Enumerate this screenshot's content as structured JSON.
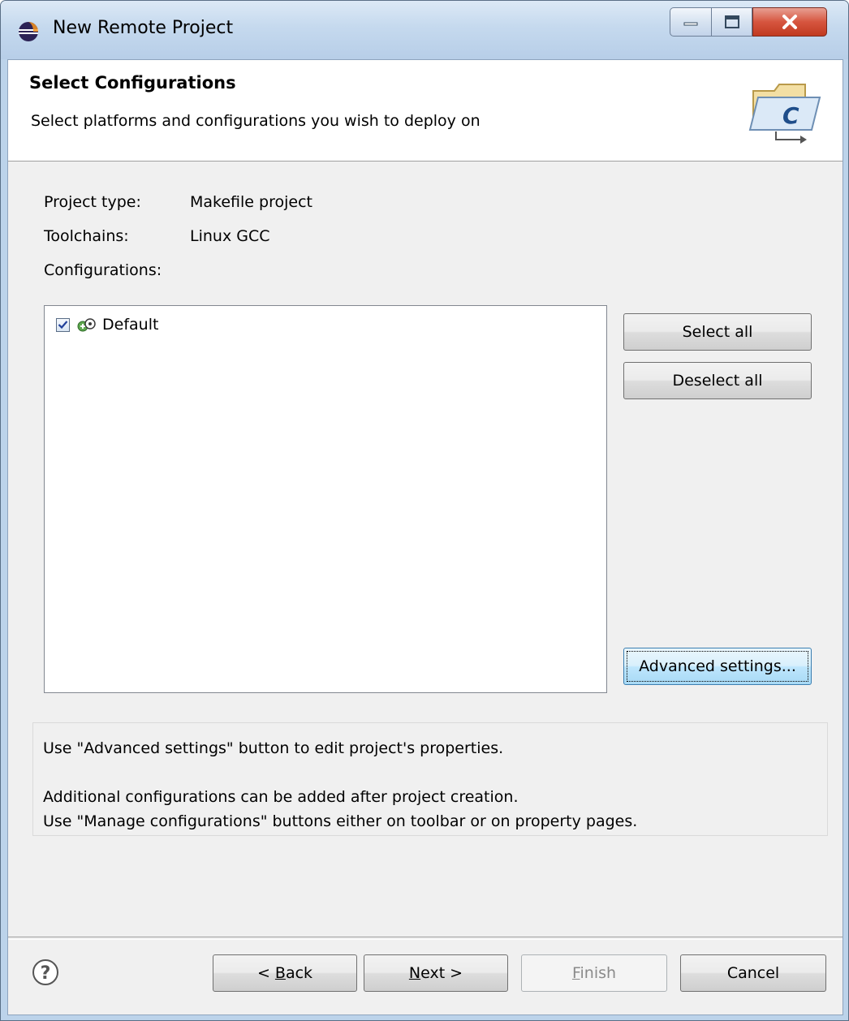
{
  "window": {
    "title": "New Remote Project",
    "controls": {
      "minimize_icon": "minimize-icon",
      "maximize_icon": "maximize-icon",
      "close_icon": "close-icon"
    }
  },
  "banner": {
    "title": "Select Configurations",
    "description": "Select platforms and configurations you wish to deploy on",
    "icon": "c-project-folder-icon"
  },
  "info": {
    "project_type_label": "Project type:",
    "project_type_value": "Makefile project",
    "toolchains_label": "Toolchains:",
    "toolchains_value": "Linux GCC",
    "configurations_label": "Configurations:"
  },
  "configurations": [
    {
      "name": "Default",
      "checked": true,
      "icon": "configuration-icon"
    }
  ],
  "side_buttons": {
    "select_all": "Select all",
    "deselect_all": "Deselect all",
    "advanced_settings": "Advanced settings..."
  },
  "hints": {
    "line1": "Use \"Advanced settings\" button to edit project's properties.",
    "line2": "Additional configurations can be added after project creation.",
    "line3": "Use \"Manage configurations\" buttons either on toolbar or on property pages."
  },
  "footer": {
    "help_icon": "help-icon",
    "back": {
      "prefix": "< ",
      "mnemonic": "B",
      "rest": "ack"
    },
    "next": {
      "mnemonic": "N",
      "rest": "ext >"
    },
    "finish": {
      "mnemonic": "F",
      "rest": "inish",
      "enabled": false
    },
    "cancel": "Cancel"
  },
  "colors": {
    "titlebar": "#c5d9ee",
    "dialog_bg": "#f0f0f0",
    "close_button": "#c13a20",
    "focus_button": "#bee6fd"
  }
}
